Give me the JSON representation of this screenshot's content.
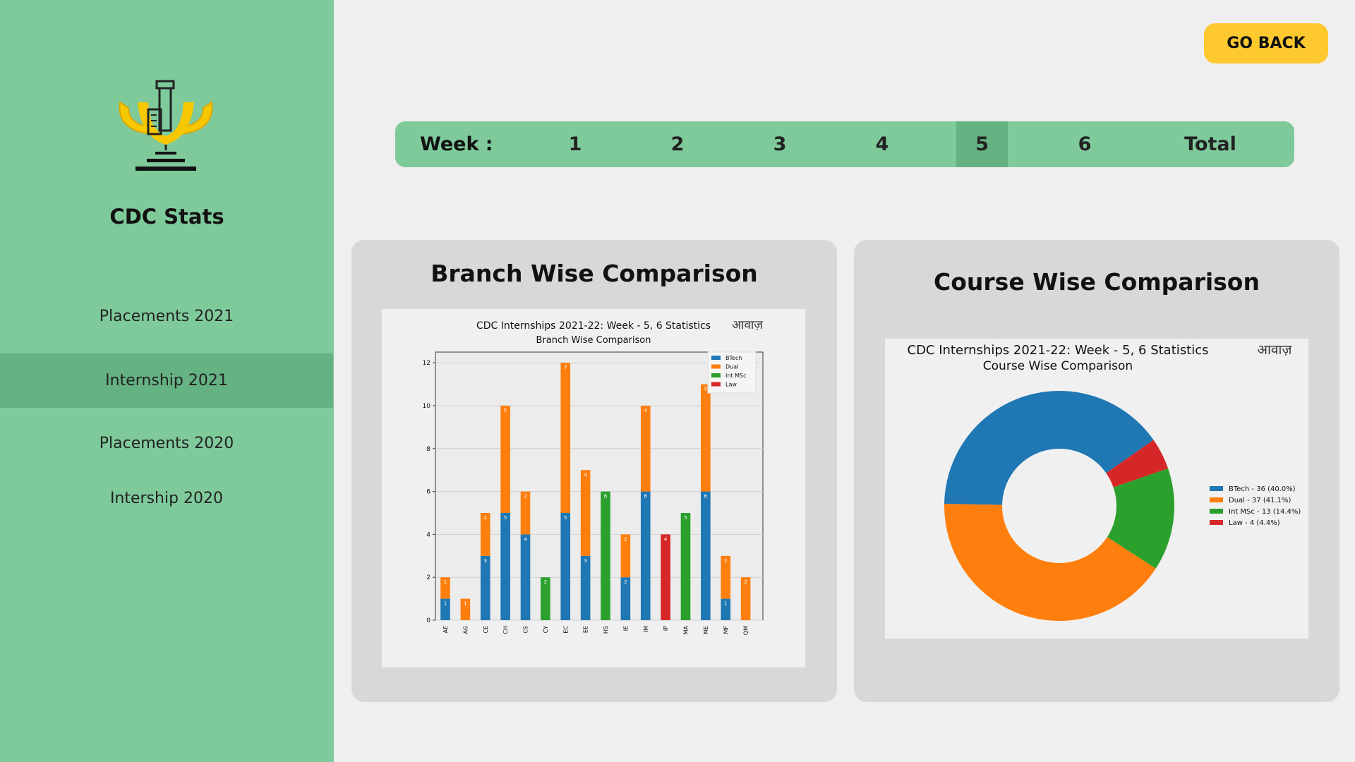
{
  "sidebar": {
    "app_title": "CDC Stats",
    "items": [
      {
        "label": "Placements 2021",
        "active": false
      },
      {
        "label": "Internship 2021",
        "active": true
      },
      {
        "label": "Placements 2020",
        "active": false
      },
      {
        "label": "Intership 2020",
        "active": false
      }
    ]
  },
  "header": {
    "go_back_label": "GO BACK"
  },
  "week_bar": {
    "label": "Week :",
    "tabs": [
      "1",
      "2",
      "3",
      "4",
      "5",
      "6",
      "Total"
    ],
    "active_index": 4
  },
  "branch_card": {
    "title": "Branch Wise Comparison"
  },
  "course_card": {
    "title": "Course Wise Comparison"
  },
  "colors": {
    "btech": "#1f77b4",
    "dual": "#ff7f0e",
    "intmsc": "#2ca02c",
    "law": "#d62728",
    "sidebar": "#7fca9b",
    "accent": "#fdc92f"
  },
  "chart_data": [
    {
      "type": "bar",
      "stacked": true,
      "title": "CDC Internships 2021-22: Week - 5, 6 Statistics",
      "subtitle": "Branch Wise Comparison",
      "watermark": "आवाज़",
      "categories": [
        "AE",
        "AG",
        "CE",
        "CH",
        "CS",
        "CY",
        "EC",
        "EE",
        "HS",
        "IE",
        "IM",
        "IP",
        "MA",
        "ME",
        "MF",
        "QM"
      ],
      "series": [
        {
          "name": "BTech",
          "values": [
            1,
            0,
            3,
            5,
            4,
            0,
            5,
            3,
            0,
            2,
            6,
            0,
            0,
            6,
            1,
            0
          ]
        },
        {
          "name": "Dual",
          "values": [
            1,
            1,
            2,
            5,
            2,
            0,
            7,
            4,
            0,
            2,
            4,
            0,
            0,
            5,
            2,
            2
          ]
        },
        {
          "name": "Int MSc",
          "values": [
            0,
            0,
            0,
            0,
            0,
            2,
            0,
            0,
            6,
            0,
            0,
            0,
            5,
            0,
            0,
            0
          ]
        },
        {
          "name": "Law",
          "values": [
            0,
            0,
            0,
            0,
            0,
            0,
            0,
            0,
            0,
            0,
            0,
            4,
            0,
            0,
            0,
            0
          ]
        }
      ],
      "yticks": [
        "0",
        "2",
        "4",
        "6",
        "8",
        "10",
        "12"
      ],
      "ylim": [
        0,
        12.5
      ],
      "legend_position": "top-right",
      "grid": true
    },
    {
      "type": "pie",
      "donut": true,
      "title": "CDC Internships 2021-22: Week - 5, 6 Statistics",
      "subtitle": "Course Wise Comparison",
      "watermark": "आवाज़",
      "slices": [
        {
          "name": "BTech",
          "value": 36,
          "legend": "BTech - 36 (40.0%)"
        },
        {
          "name": "Dual",
          "value": 37,
          "legend": "Dual - 37 (41.1%)"
        },
        {
          "name": "Int MSc",
          "value": 13,
          "legend": "Int MSc - 13 (14.4%)"
        },
        {
          "name": "Law",
          "value": 4,
          "legend": "Law - 4 (4.4%)"
        }
      ],
      "legend_position": "right"
    }
  ]
}
